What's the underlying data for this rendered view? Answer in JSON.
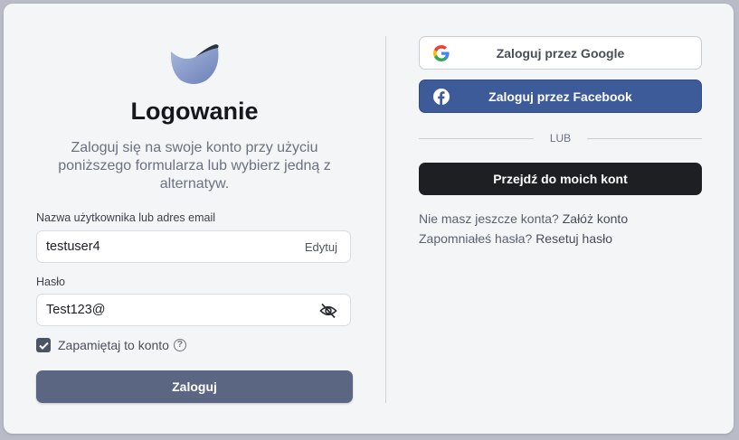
{
  "login": {
    "title": "Logowanie",
    "subtitle": "Zaloguj się na swoje konto przy użyciu poniższego formularza lub wybierz jedną z alternatyw.",
    "username_label": "Nazwa użytkownika lub adres email",
    "username_value": "testuser4",
    "edit_label": "Edytuj",
    "password_label": "Hasło",
    "password_value": "Test123@",
    "remember_label": "Zapamiętaj to konto",
    "remember_checked": true,
    "help_glyph": "?",
    "submit_label": "Zaloguj"
  },
  "alternatives": {
    "google_label": "Zaloguj przez Google",
    "facebook_label": "Zaloguj przez Facebook",
    "or_label": "LUB",
    "accounts_label": "Przejdź do moich kont",
    "no_account_text": "Nie masz jeszcze konta?",
    "register_link": "Załóż konto",
    "forgot_text": "Zapomniałeś hasła?",
    "reset_link": "Resetuj hasło"
  },
  "colors": {
    "primary_button": "#5b6782",
    "facebook": "#3d5a99",
    "dark_button": "#1d1f23",
    "card_background": "#f4f5f7"
  },
  "icons": [
    "logo-icon",
    "google-icon",
    "facebook-icon",
    "eye-off-icon",
    "check-icon",
    "help-icon"
  ]
}
